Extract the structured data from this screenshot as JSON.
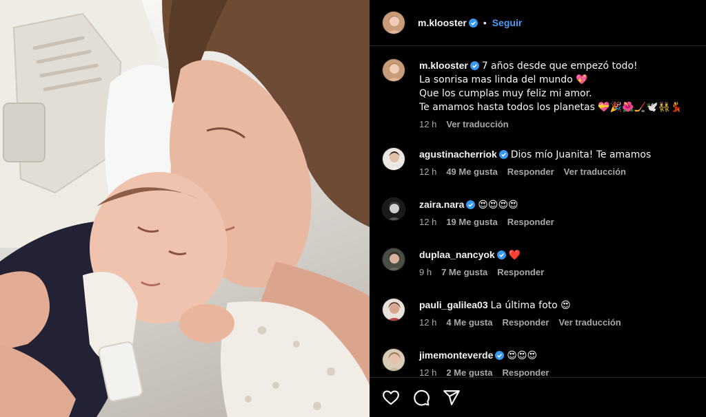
{
  "post": {
    "username": "m.klooster",
    "follow_label": "Seguir",
    "separator": "•"
  },
  "caption": {
    "username": "m.klooster",
    "lines": [
      "7 años desde que empezó todo!",
      "La sonrisa mas linda del mundo 💖",
      "Que los cumplas muy feliz mi amor.",
      "Te amamos hasta todos los planetas 💝🎉🌺🏒🕊️👯‍♀️💃"
    ],
    "time": "12 h",
    "translate": "Ver traducción"
  },
  "comments": [
    {
      "username": "agustinacherriok",
      "verified": true,
      "text": "Dios mío Juanita! Te amamos",
      "time": "12 h",
      "likes": "49 Me gusta",
      "reply": "Responder",
      "translate": "Ver traducción"
    },
    {
      "username": "zaira.nara",
      "verified": true,
      "text": "😍😍😍😍",
      "time": "12 h",
      "likes": "19 Me gusta",
      "reply": "Responder",
      "translate": ""
    },
    {
      "username": "duplaa_nancyok",
      "verified": true,
      "text": "❤️",
      "time": "9 h",
      "likes": "7 Me gusta",
      "reply": "Responder",
      "translate": ""
    },
    {
      "username": "pauli_galilea03",
      "verified": false,
      "text": "La última foto 😍",
      "time": "12 h",
      "likes": "4 Me gusta",
      "reply": "Responder",
      "translate": "Ver traducción"
    },
    {
      "username": "jimemonteverde",
      "verified": true,
      "text": "😍😍😍",
      "time": "12 h",
      "likes": "2 Me gusta",
      "reply": "Responder",
      "translate": ""
    }
  ],
  "icons": {
    "like": "heart-icon",
    "comment": "comment-icon",
    "share": "share-icon",
    "verified": "verified-badge-icon"
  },
  "colors": {
    "background": "#000000",
    "link": "#4a9df8",
    "muted": "#a8a8a8",
    "verified": "#3897f0"
  }
}
